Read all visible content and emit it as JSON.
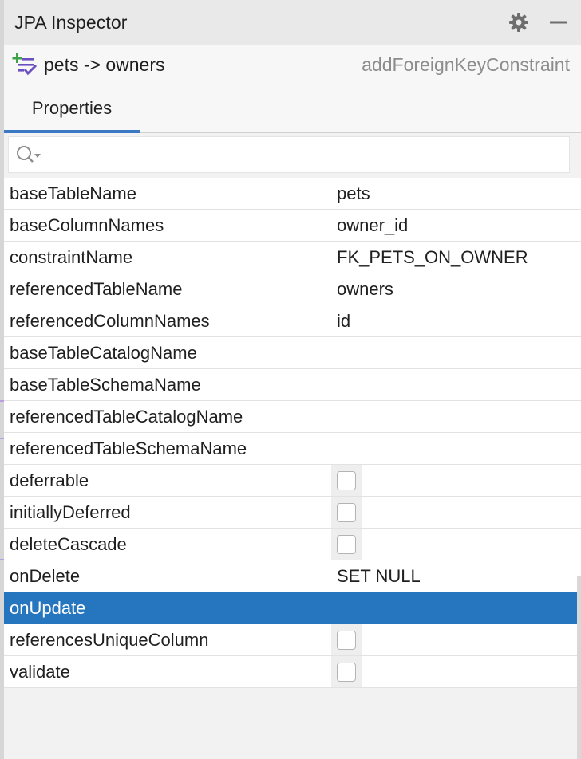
{
  "window": {
    "title": "JPA Inspector"
  },
  "icons": {
    "settings": "gear-icon",
    "minimize": "minimize-icon",
    "entity": "add-foreign-key-icon",
    "search": "search-icon"
  },
  "header": {
    "entity_name": "pets -> owners",
    "entity_type": "addForeignKeyConstraint"
  },
  "tabs": [
    {
      "label": "Properties",
      "active": true
    }
  ],
  "search": {
    "placeholder": "",
    "value": ""
  },
  "properties": [
    {
      "name": "baseTableName",
      "value": "pets",
      "kind": "text"
    },
    {
      "name": "baseColumnNames",
      "value": "owner_id",
      "kind": "text"
    },
    {
      "name": "constraintName",
      "value": "FK_PETS_ON_OWNER",
      "kind": "text"
    },
    {
      "name": "referencedTableName",
      "value": "owners",
      "kind": "text"
    },
    {
      "name": "referencedColumnNames",
      "value": "id",
      "kind": "text"
    },
    {
      "name": "baseTableCatalogName",
      "value": "",
      "kind": "text"
    },
    {
      "name": "baseTableSchemaName",
      "value": "",
      "kind": "text"
    },
    {
      "name": "referencedTableCatalogName",
      "value": "",
      "kind": "text"
    },
    {
      "name": "referencedTableSchemaName",
      "value": "",
      "kind": "text"
    },
    {
      "name": "deferrable",
      "value": "",
      "kind": "checkbox",
      "checked": false
    },
    {
      "name": "initiallyDeferred",
      "value": "",
      "kind": "checkbox",
      "checked": false
    },
    {
      "name": "deleteCascade",
      "value": "",
      "kind": "checkbox",
      "checked": false
    },
    {
      "name": "onDelete",
      "value": "SET NULL",
      "kind": "text"
    },
    {
      "name": "onUpdate",
      "value": "",
      "kind": "text",
      "selected": true
    },
    {
      "name": "referencesUniqueColumn",
      "value": "",
      "kind": "checkbox",
      "checked": false
    },
    {
      "name": "validate",
      "value": "",
      "kind": "checkbox",
      "checked": false
    }
  ],
  "colors": {
    "accent": "#3c79c4",
    "selection": "#2675bf",
    "entity_icon_plus": "#3fa14a",
    "entity_icon_check": "#6b4fc0"
  }
}
